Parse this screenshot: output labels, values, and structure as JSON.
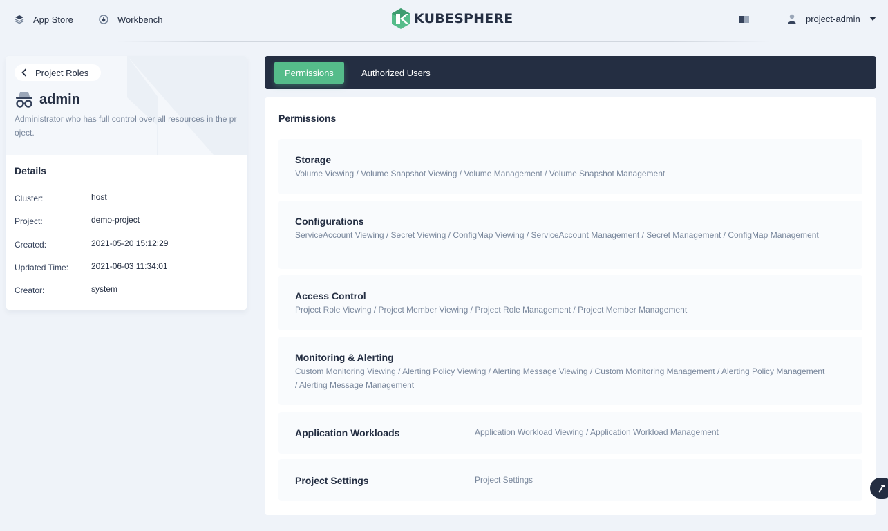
{
  "header": {
    "app_store": "App Store",
    "workbench": "Workbench",
    "logo_text": "KUBESPHERE",
    "username": "project-admin"
  },
  "colors": {
    "accent": "#55bc8a",
    "dark": "#242e42",
    "muted": "#79879c",
    "background": "#eff3f9"
  },
  "role": {
    "back_label": "Project Roles",
    "name": "admin",
    "description": "Administrator who has full control over all resources in the project."
  },
  "details": {
    "title": "Details",
    "rows": [
      {
        "label": "Cluster:",
        "value": "host"
      },
      {
        "label": "Project:",
        "value": "demo-project"
      },
      {
        "label": "Created:",
        "value": "2021-05-20 15:12:29"
      },
      {
        "label": "Updated Time:",
        "value": "2021-06-03 11:34:01"
      },
      {
        "label": "Creator:",
        "value": "system"
      }
    ]
  },
  "tabs": [
    {
      "label": "Permissions",
      "active": true
    },
    {
      "label": "Authorized Users",
      "active": false
    }
  ],
  "permissions": {
    "title": "Permissions",
    "groups": [
      {
        "name": "Storage",
        "items": "Volume Viewing / Volume Snapshot Viewing / Volume Management / Volume Snapshot Management"
      },
      {
        "name": "Configurations",
        "items": "ServiceAccount Viewing / Secret Viewing / ConfigMap Viewing / ServiceAccount Management / Secret Management / ConfigMap Management"
      },
      {
        "name": "Access Control",
        "items": "Project Role Viewing / Project Member Viewing / Project Role Management / Project Member Management"
      },
      {
        "name": "Monitoring & Alerting",
        "items": "Custom Monitoring Viewing / Alerting Policy Viewing / Alerting Message Viewing / Custom Monitoring Management / Alerting Policy Management / Alerting Message Management"
      },
      {
        "name": "Application Workloads",
        "items": "Application Workload Viewing / Application Workload Management"
      },
      {
        "name": "Project Settings",
        "items": "Project Settings"
      }
    ]
  },
  "icons": {
    "app_store": "layers-icon",
    "workbench": "dashboard-icon",
    "docs": "book-icon",
    "user": "user-icon",
    "role": "incognito-icon",
    "back": "chevron-left-icon",
    "tool": "hammer-icon"
  }
}
